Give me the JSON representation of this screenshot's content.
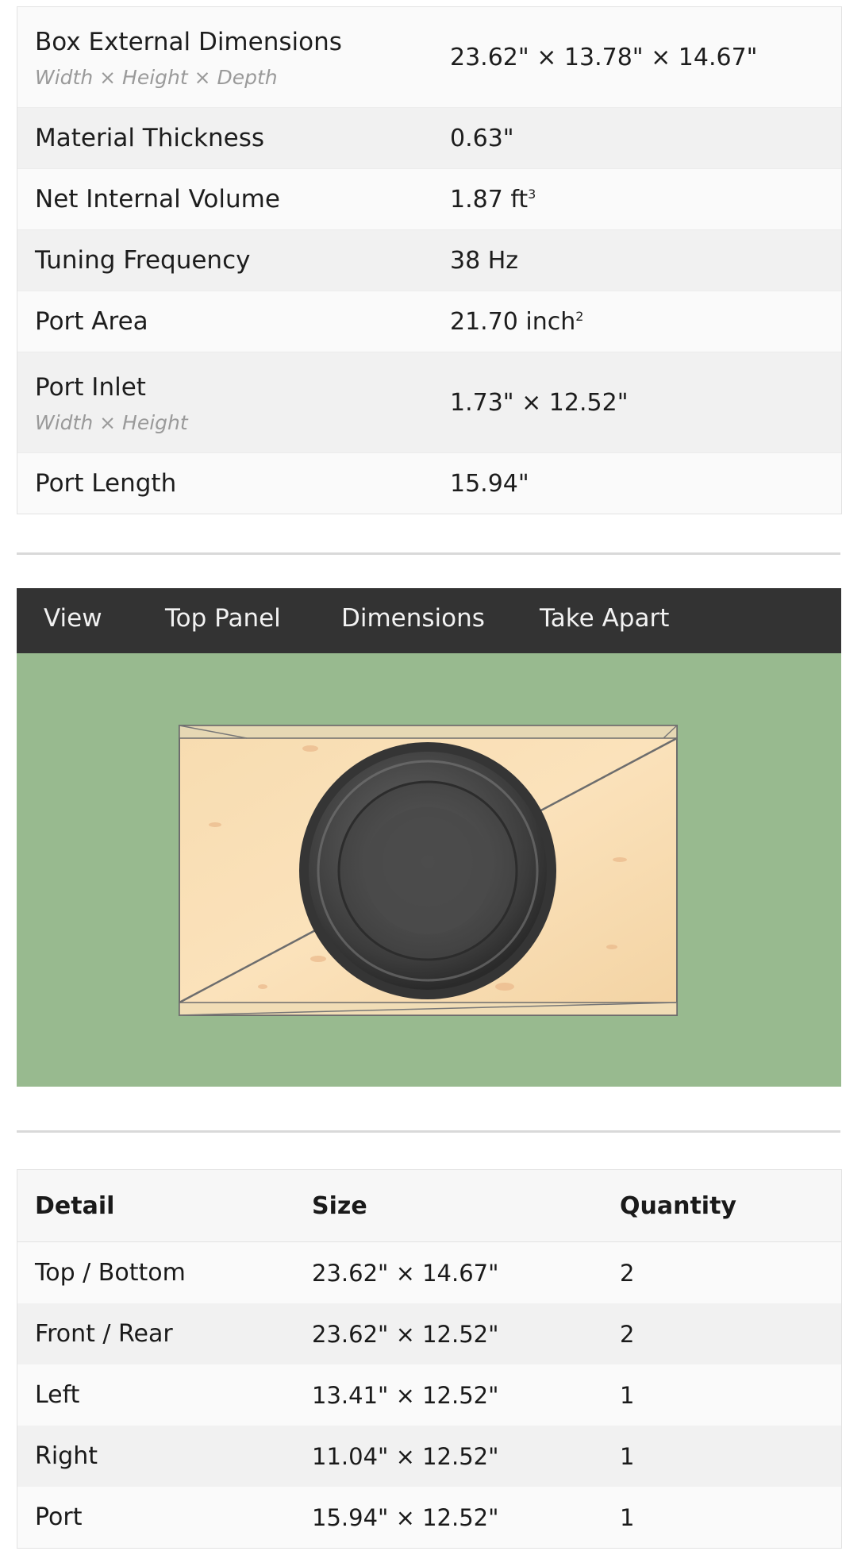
{
  "specs": {
    "rows": [
      {
        "label": "Box External Dimensions",
        "sub": "Width × Height × Depth",
        "value": "23.62\" × 13.78\" × 14.67\""
      },
      {
        "label": "Material Thickness",
        "value": "0.63\""
      },
      {
        "label": "Net Internal Volume",
        "value": "1.87 ft",
        "value_sup": "3"
      },
      {
        "label": "Tuning Frequency",
        "value": "38 Hz"
      },
      {
        "label": "Port Area",
        "value": "21.70 inch",
        "value_sup": "2"
      },
      {
        "label": "Port Inlet",
        "sub": "Width × Height",
        "value": "1.73\" × 12.52\""
      },
      {
        "label": "Port Length",
        "value": "15.94\""
      }
    ]
  },
  "viewer": {
    "tabs": [
      "View",
      "Top Panel",
      "Dimensions",
      "Take Apart"
    ],
    "background_color": "#98ba8f",
    "toolbar_color": "#333333"
  },
  "parts_table": {
    "headers": [
      "Detail",
      "Size",
      "Quantity"
    ],
    "rows": [
      {
        "detail": "Top / Bottom",
        "size": "23.62\" × 14.67\"",
        "qty": "2"
      },
      {
        "detail": "Front / Rear",
        "size": "23.62\" × 12.52\"",
        "qty": "2"
      },
      {
        "detail": "Left",
        "size": "13.41\" × 12.52\"",
        "qty": "1"
      },
      {
        "detail": "Right",
        "size": "11.04\" × 12.52\"",
        "qty": "1"
      },
      {
        "detail": "Port",
        "size": "15.94\" × 12.52\"",
        "qty": "1"
      }
    ]
  }
}
